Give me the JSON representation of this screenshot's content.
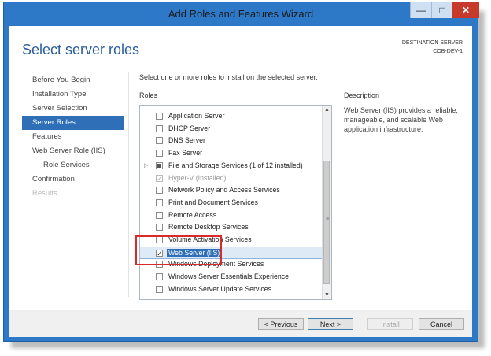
{
  "window": {
    "title": "Add Roles and Features Wizard",
    "buttons": {
      "minimize": "—",
      "maximize": "□",
      "close": "✕"
    }
  },
  "page": {
    "heading": "Select server roles",
    "destination_label": "DESTINATION SERVER",
    "destination_server": "COB-DEV-1"
  },
  "nav": {
    "items": [
      {
        "label": "Before You Begin",
        "state": "normal"
      },
      {
        "label": "Installation Type",
        "state": "normal"
      },
      {
        "label": "Server Selection",
        "state": "normal"
      },
      {
        "label": "Server Roles",
        "state": "active"
      },
      {
        "label": "Features",
        "state": "normal"
      },
      {
        "label": "Web Server Role (IIS)",
        "state": "normal"
      },
      {
        "label": "Role Services",
        "state": "sub"
      },
      {
        "label": "Confirmation",
        "state": "normal"
      },
      {
        "label": "Results",
        "state": "disabled"
      }
    ]
  },
  "main": {
    "instruction": "Select one or more roles to install on the selected server.",
    "roles_label": "Roles",
    "description_label": "Description",
    "description_text": "Web Server (IIS) provides a reliable, manageable, and scalable Web application infrastructure."
  },
  "roles": [
    {
      "label": "Application Server",
      "checked": false
    },
    {
      "label": "DHCP Server",
      "checked": false
    },
    {
      "label": "DNS Server",
      "checked": false
    },
    {
      "label": "Fax Server",
      "checked": false
    },
    {
      "label": "File and Storage Services (1 of 12 installed)",
      "checked": "partial",
      "expandable": true
    },
    {
      "label": "Hyper-V (Installed)",
      "checked": true,
      "disabled": true
    },
    {
      "label": "Network Policy and Access Services",
      "checked": false
    },
    {
      "label": "Print and Document Services",
      "checked": false
    },
    {
      "label": "Remote Access",
      "checked": false
    },
    {
      "label": "Remote Desktop Services",
      "checked": false
    },
    {
      "label": "Volume Activation Services",
      "checked": false
    },
    {
      "label": "Web Server (IIS)",
      "checked": true,
      "selected": true
    },
    {
      "label": "Windows Deployment Services",
      "checked": false
    },
    {
      "label": "Windows Server Essentials Experience",
      "checked": false
    },
    {
      "label": "Windows Server Update Services",
      "checked": false
    }
  ],
  "glyphs": {
    "check": "✓",
    "expand": "▷",
    "scroll_up": "▲",
    "scroll_down": "▼",
    "grip": "≡"
  },
  "footer": {
    "previous": "< Previous",
    "next": "Next >",
    "install": "Install",
    "cancel": "Cancel"
  },
  "colors": {
    "title_bar": "#2e78c8",
    "active_nav": "#2f6fb7",
    "heading": "#2a5d9c",
    "highlight_box": "#d8292b"
  }
}
